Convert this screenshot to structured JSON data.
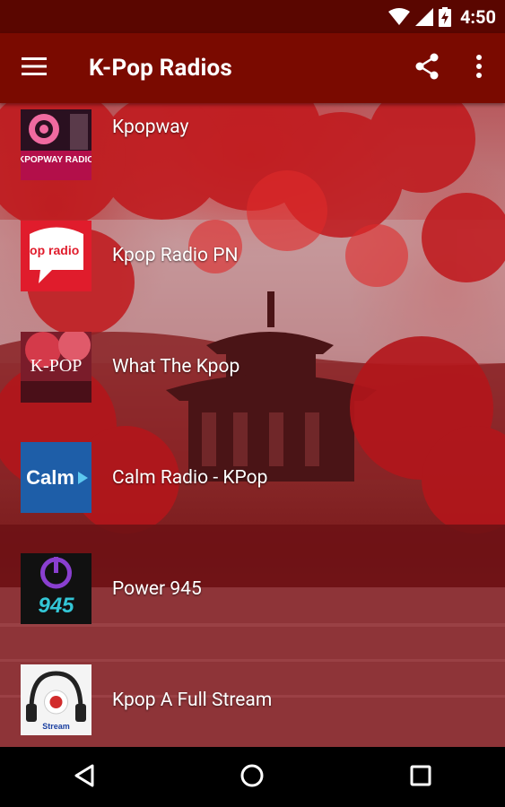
{
  "status_bar": {
    "time": "4:50",
    "icons": [
      "wifi-icon",
      "cell-signal-icon",
      "battery-charging-icon"
    ]
  },
  "app_bar": {
    "title": "K-Pop Radios",
    "menu_icon": "menu-icon",
    "actions": [
      "share-icon",
      "more-vert-icon"
    ],
    "color": "#7a0a00"
  },
  "stations": [
    {
      "name": "Kpopway",
      "logo": "kpopway-radio-logo",
      "logo_text": "KPOPWAY RADIO"
    },
    {
      "name": "Kpop Radio PN",
      "logo": "kpop-radio-pn-logo",
      "logo_text": "kpop radio pn"
    },
    {
      "name": "What The Kpop",
      "logo": "what-the-kpop-logo",
      "logo_text": "K-POP"
    },
    {
      "name": "Calm Radio - KPop",
      "logo": "calm-radio-logo",
      "logo_text": "Calm"
    },
    {
      "name": "Power 945",
      "logo": "power-945-logo",
      "logo_text": "945"
    },
    {
      "name": "Kpop A Full Stream",
      "logo": "kpop-full-stream-logo",
      "logo_text": "Stream"
    }
  ],
  "nav_bar": {
    "buttons": [
      "back-icon",
      "home-icon",
      "recents-icon"
    ]
  }
}
